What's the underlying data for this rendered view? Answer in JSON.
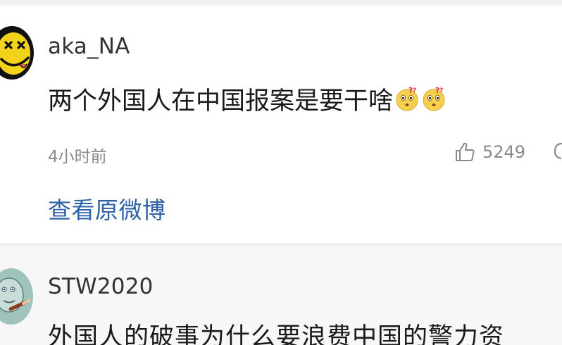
{
  "comments": [
    {
      "username": "aka_NA",
      "text": "两个外国人在中国报案是要干啥",
      "emojis": [
        "confused-face-icon",
        "confused-face-icon"
      ],
      "time": "4小时前",
      "likes": "5249",
      "view_link": "查看原微博"
    },
    {
      "username": "STW2020",
      "text": "外国人的破事为什么要浪费中国的警力资"
    }
  ],
  "colors": {
    "link": "#2f62a6",
    "meta": "#8a8a8a",
    "text": "#1a1a1a"
  }
}
